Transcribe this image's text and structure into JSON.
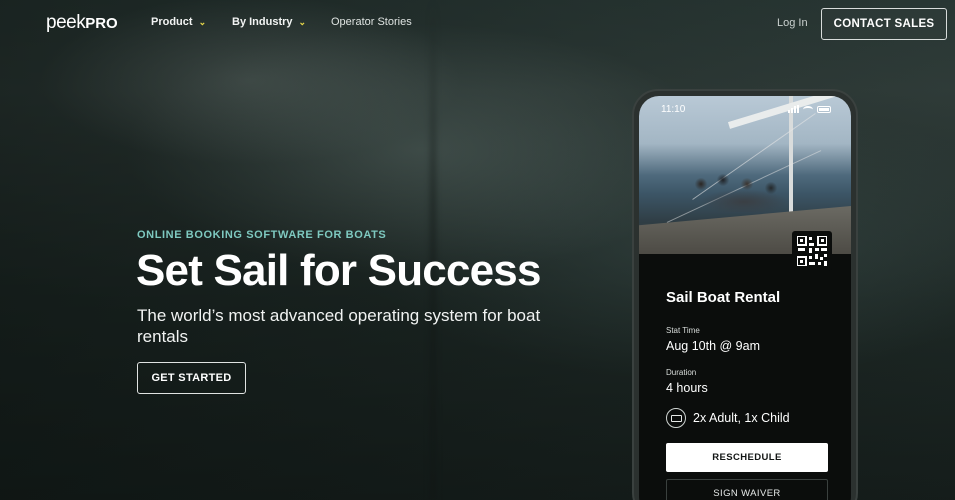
{
  "header": {
    "logo_light": "peek",
    "logo_bold": "PRO",
    "nav": [
      {
        "label": "Product"
      },
      {
        "label": "By Industry"
      },
      {
        "label": "Operator Stories"
      }
    ],
    "login_label": "Log In",
    "contact_label": "CONTACT SALES"
  },
  "hero": {
    "eyebrow": "ONLINE BOOKING SOFTWARE FOR BOATS",
    "headline": "Set Sail for Success",
    "subhead": "The world’s most advanced operating system for boat rentals",
    "cta_label": "GET STARTED"
  },
  "phone": {
    "status_time": "11:10",
    "booking": {
      "title": "Sail Boat Rental",
      "start_label": "Stat Time",
      "start_value": "Aug 10th @ 9am",
      "duration_label": "Duration",
      "duration_value": "4 hours",
      "guests": "2x Adult, 1x Child",
      "reschedule_label": "RESCHEDULE",
      "waiver_label": "SIGN WAIVER"
    }
  },
  "colors": {
    "eyebrow": "#7ec9c0",
    "chevron": "#e8d84a",
    "background": "#1a2420"
  },
  "icons": {
    "nav_dropdown": "chevron-down-icon",
    "qr": "qr-code-icon",
    "guests": "ticket-icon"
  }
}
